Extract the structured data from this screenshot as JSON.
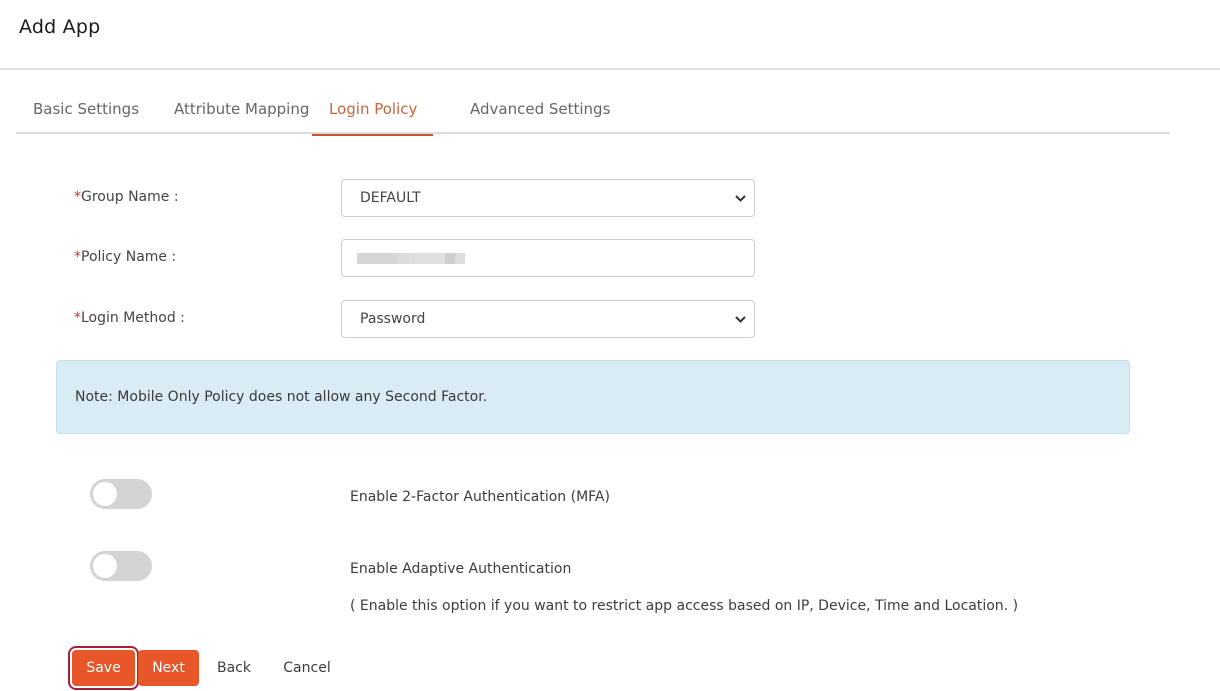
{
  "header": {
    "title": "Add App"
  },
  "tabs": [
    {
      "label": "Basic Settings",
      "active": false
    },
    {
      "label": "Attribute Mapping",
      "active": false
    },
    {
      "label": "Login Policy",
      "active": true
    },
    {
      "label": "Advanced Settings",
      "active": false
    }
  ],
  "form": {
    "required_marker": "*",
    "group_name": {
      "label": "Group Name :",
      "value": "DEFAULT",
      "icon": "chevron-down-icon"
    },
    "policy_name": {
      "label": "Policy Name :",
      "value": "",
      "value_redacted": true
    },
    "login_method": {
      "label": "Login Method :",
      "value": "Password",
      "icon": "chevron-down-icon"
    }
  },
  "note": {
    "text": "Note: Mobile Only Policy does not allow any Second Factor."
  },
  "toggles": [
    {
      "label": "Enable 2-Factor Authentication (MFA)",
      "enabled": false
    },
    {
      "label": "Enable Adaptive Authentication",
      "enabled": false
    }
  ],
  "adaptive_hint": "( Enable this option if you want to restrict app access based on IP, Device, Time and Location. )",
  "actions": {
    "save": "Save",
    "next": "Next",
    "back": "Back",
    "cancel": "Cancel"
  },
  "colors": {
    "accent": "#e8572a",
    "active_tab": "#c8643c",
    "note_bg": "#d9ebf5",
    "toggle_off": "#d4d4d4",
    "required": "#c0392b",
    "focus_outline": "#a3213a"
  }
}
